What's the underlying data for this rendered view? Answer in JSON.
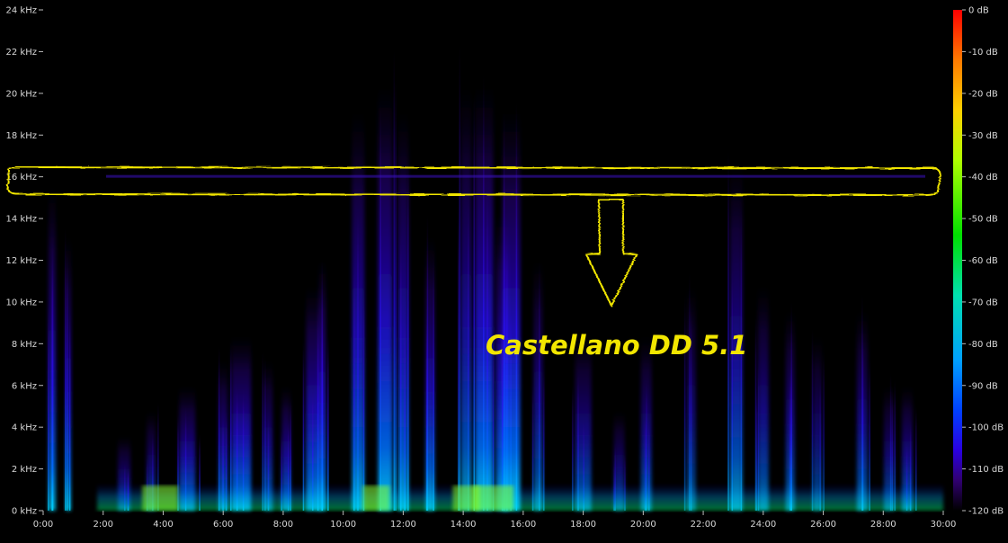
{
  "chart_data": {
    "type": "heatmap",
    "title": "",
    "xlabel": "",
    "ylabel": "",
    "x_unit": "time (mm:ss)",
    "xlim": [
      "0:00",
      "30:00"
    ],
    "ylim_khz": [
      0,
      24
    ],
    "x_ticks": [
      "0:00",
      "2:00",
      "4:00",
      "6:00",
      "8:00",
      "10:00",
      "12:00",
      "14:00",
      "16:00",
      "18:00",
      "20:00",
      "22:00",
      "24:00",
      "26:00",
      "28:00",
      "30:00"
    ],
    "y_ticks": [
      "0 kHz",
      "2 kHz",
      "4 kHz",
      "6 kHz",
      "8 kHz",
      "10 kHz",
      "12 kHz",
      "14 kHz",
      "16 kHz",
      "18 kHz",
      "20 kHz",
      "22 kHz",
      "24 kHz"
    ],
    "colorbar": {
      "ticks": [
        "0 dB",
        "-10 dB",
        "-20 dB",
        "-30 dB",
        "-40 dB",
        "-50 dB",
        "-60 dB",
        "-70 dB",
        "-80 dB",
        "-90 dB",
        "-100 dB",
        "-110 dB",
        "-120 dB"
      ],
      "range_db": [
        -120,
        0
      ],
      "colors": [
        "#ff0000",
        "#ff7a00",
        "#ffd000",
        "#b0ff00",
        "#00e000",
        "#00e0b0",
        "#00a0ff",
        "#0040ff",
        "#2a00e0",
        "#300070",
        "#000000"
      ]
    },
    "annotation": {
      "text": "Castellano DD 5.1",
      "highlighted_band_khz": [
        15.2,
        16.8
      ],
      "color": "#f2e600"
    },
    "background": "#000000",
    "grid": false
  }
}
